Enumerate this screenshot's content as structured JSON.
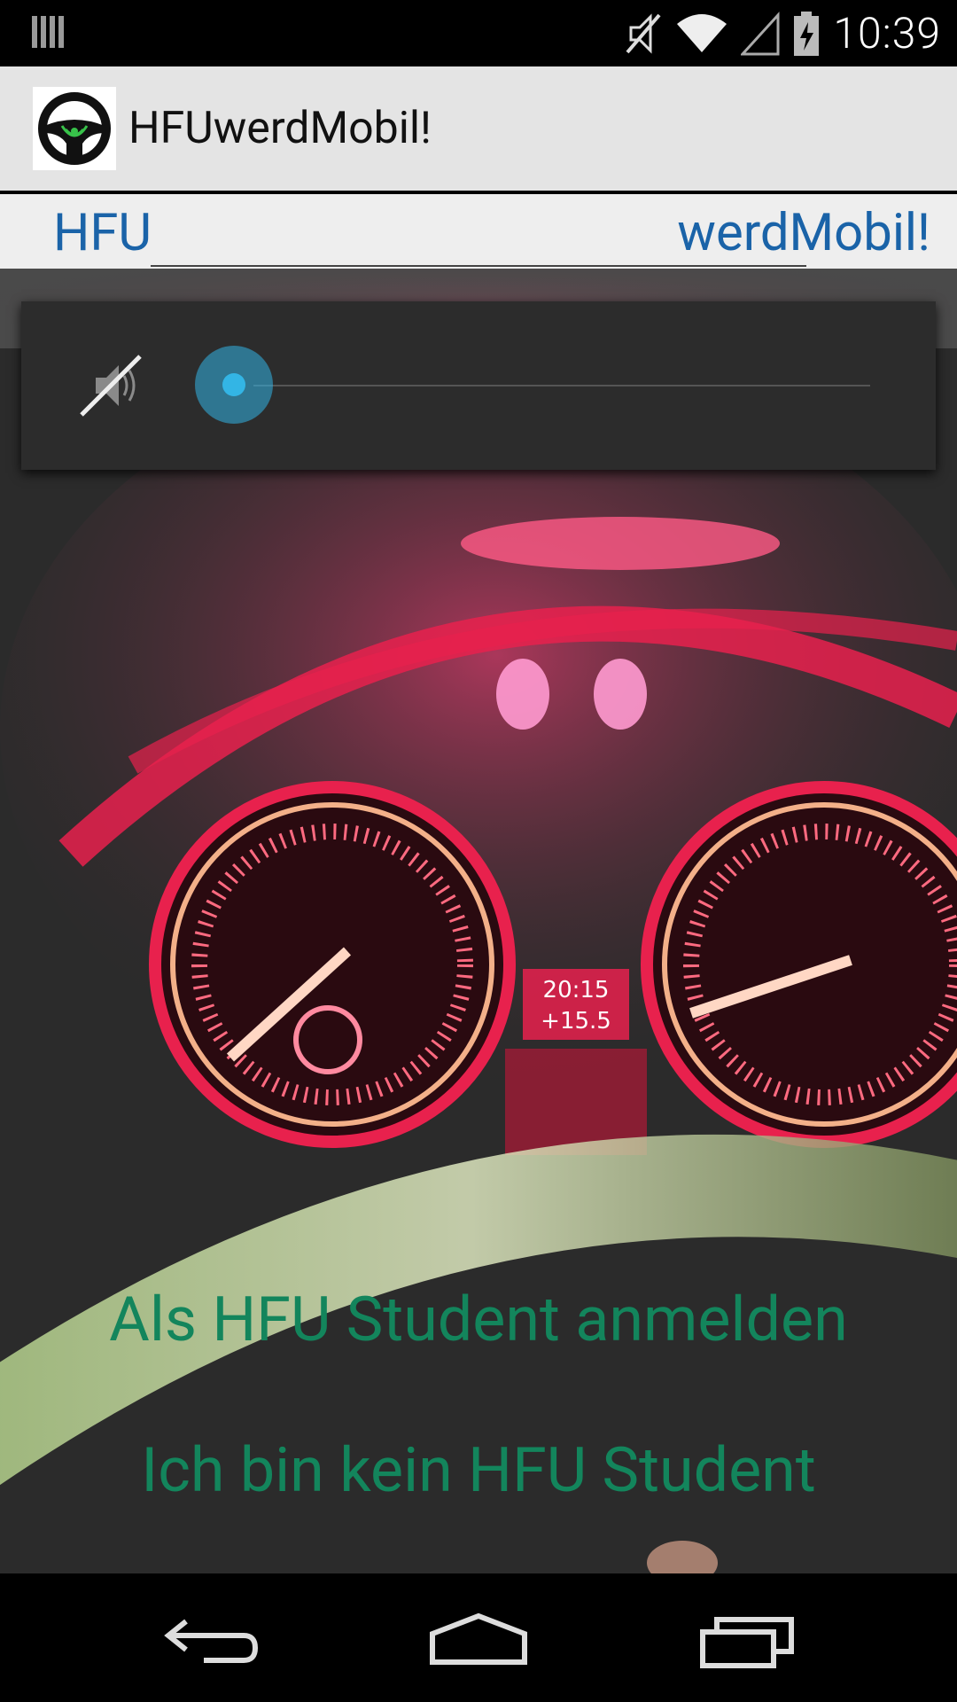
{
  "status_bar": {
    "time": "10:39",
    "icons": [
      "sim-icon",
      "mute-icon",
      "wifi-icon",
      "signal-icon",
      "battery-icon"
    ]
  },
  "action_bar": {
    "title": "HFUwerdMobil!",
    "icon": "steering-wheel-icon"
  },
  "strip": {
    "left_label": "HFU",
    "right_label": "werdMobil!"
  },
  "volume": {
    "icon": "speaker-mute-icon",
    "level": 0
  },
  "dashboard_readout": {
    "time": "20:15",
    "temp": "+15.5"
  },
  "actions": {
    "login_hfu": "Als HFU Student anmelden",
    "not_hfu": "Ich bin kein HFU Student"
  },
  "colors": {
    "accent": "#33b5e5",
    "link_blue": "#1a63a8",
    "text_green": "#13855c"
  },
  "nav": {
    "icons": [
      "back-icon",
      "home-icon",
      "recents-icon"
    ]
  }
}
